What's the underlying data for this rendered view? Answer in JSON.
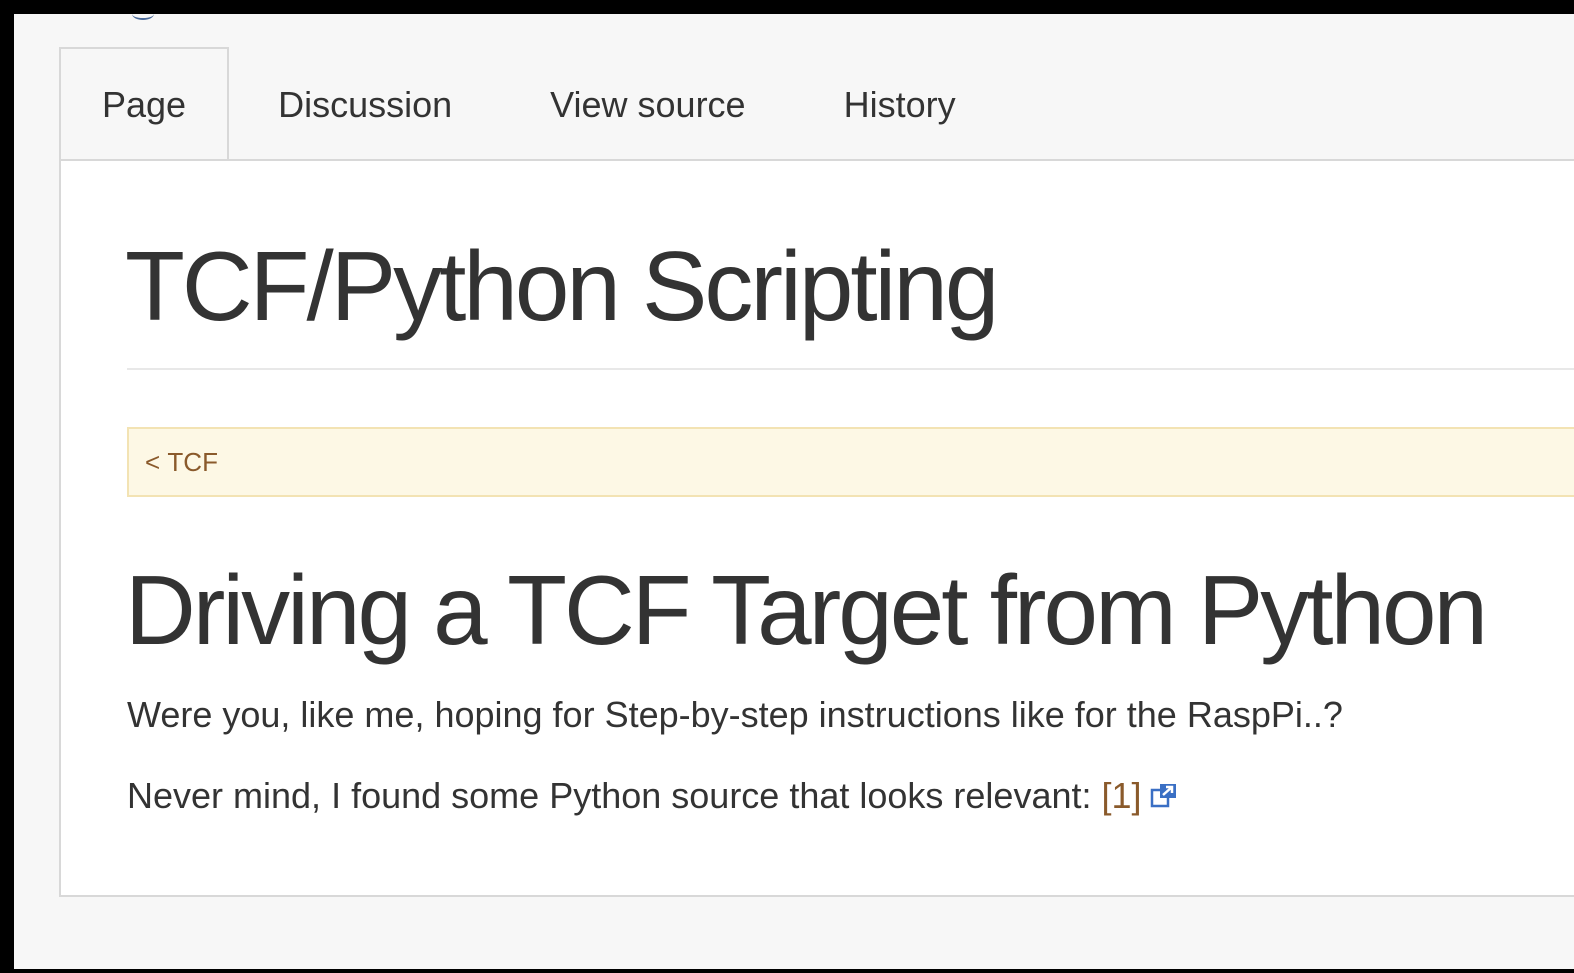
{
  "tabs": [
    {
      "label": "Page",
      "selected": true
    },
    {
      "label": "Discussion",
      "selected": false
    },
    {
      "label": "View source",
      "selected": false
    },
    {
      "label": "History",
      "selected": false
    }
  ],
  "page": {
    "title": "TCF/Python Scripting",
    "breadcrumb": {
      "prefix": "< ",
      "link": "TCF"
    },
    "heading": "Driving a TCF Target from Python",
    "paragraphs": {
      "p1": "Were you, like me, hoping for Step-by-step instructions like for the RaspPi..?",
      "p2_text": "Never mind, I found some Python source that looks relevant: ",
      "p2_link": "[1]",
      "p2_link_icon": "external-link-icon"
    }
  },
  "colors": {
    "link": "#8a5a2b",
    "external_icon": "#3a6fc4",
    "breadcrumb_bg": "#fdf8e5",
    "text": "#333333"
  }
}
